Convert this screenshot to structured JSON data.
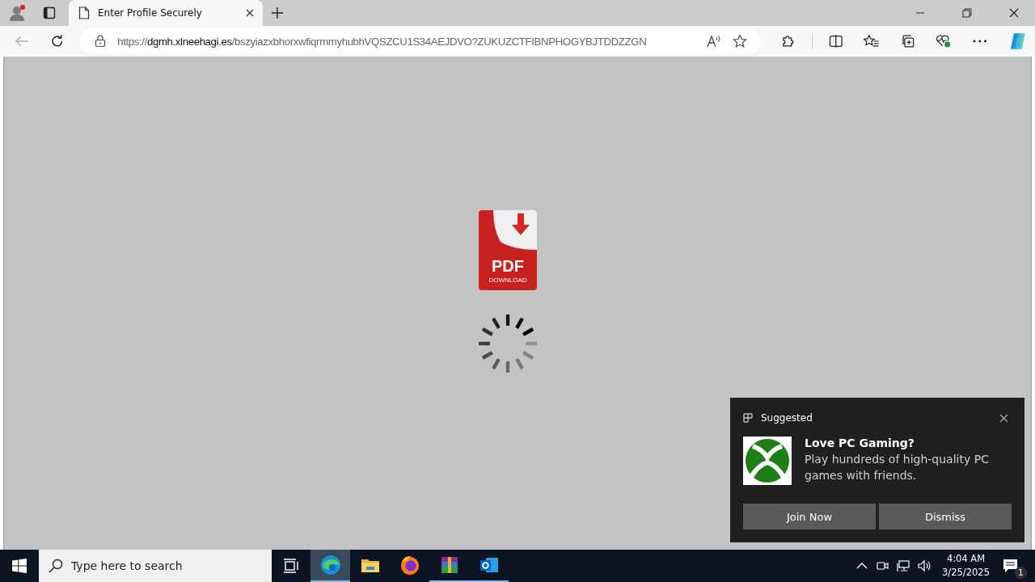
{
  "browser": {
    "tabs": [
      {
        "title": "Enter Profile Securely",
        "selected": true
      }
    ],
    "profile_alert": true,
    "address": {
      "scheme": "https://",
      "host": "dgmh.xlneehagi.es",
      "path": "/bszyiazxbhorxwfiqrmmyhubhVQSZCU1S34AEJDVO?ZUKUZCTFIBNPHOGYBJTDDZZGN"
    },
    "back_disabled": true
  },
  "page": {
    "badge_title": "PDF",
    "badge_subtitle": "DOWNLOAD"
  },
  "toast": {
    "header": "Suggested",
    "title": "Love PC Gaming?",
    "body": "Play hundreds of high-quality PC games with friends.",
    "buttons": [
      "Join Now",
      "Dismiss"
    ]
  },
  "taskbar": {
    "search": {
      "placeholder": "Type here to search"
    },
    "apps": [
      {
        "kind": "edge",
        "selected": true,
        "running": true
      },
      {
        "kind": "explorer",
        "selected": false,
        "running": false
      },
      {
        "kind": "firefox",
        "selected": false,
        "running": false
      },
      {
        "kind": "winrar",
        "selected": false,
        "running": true
      },
      {
        "kind": "outlook",
        "selected": false,
        "running": true
      }
    ],
    "time": "4:04 AM",
    "date": "3/25/2025",
    "notifications": "1"
  }
}
